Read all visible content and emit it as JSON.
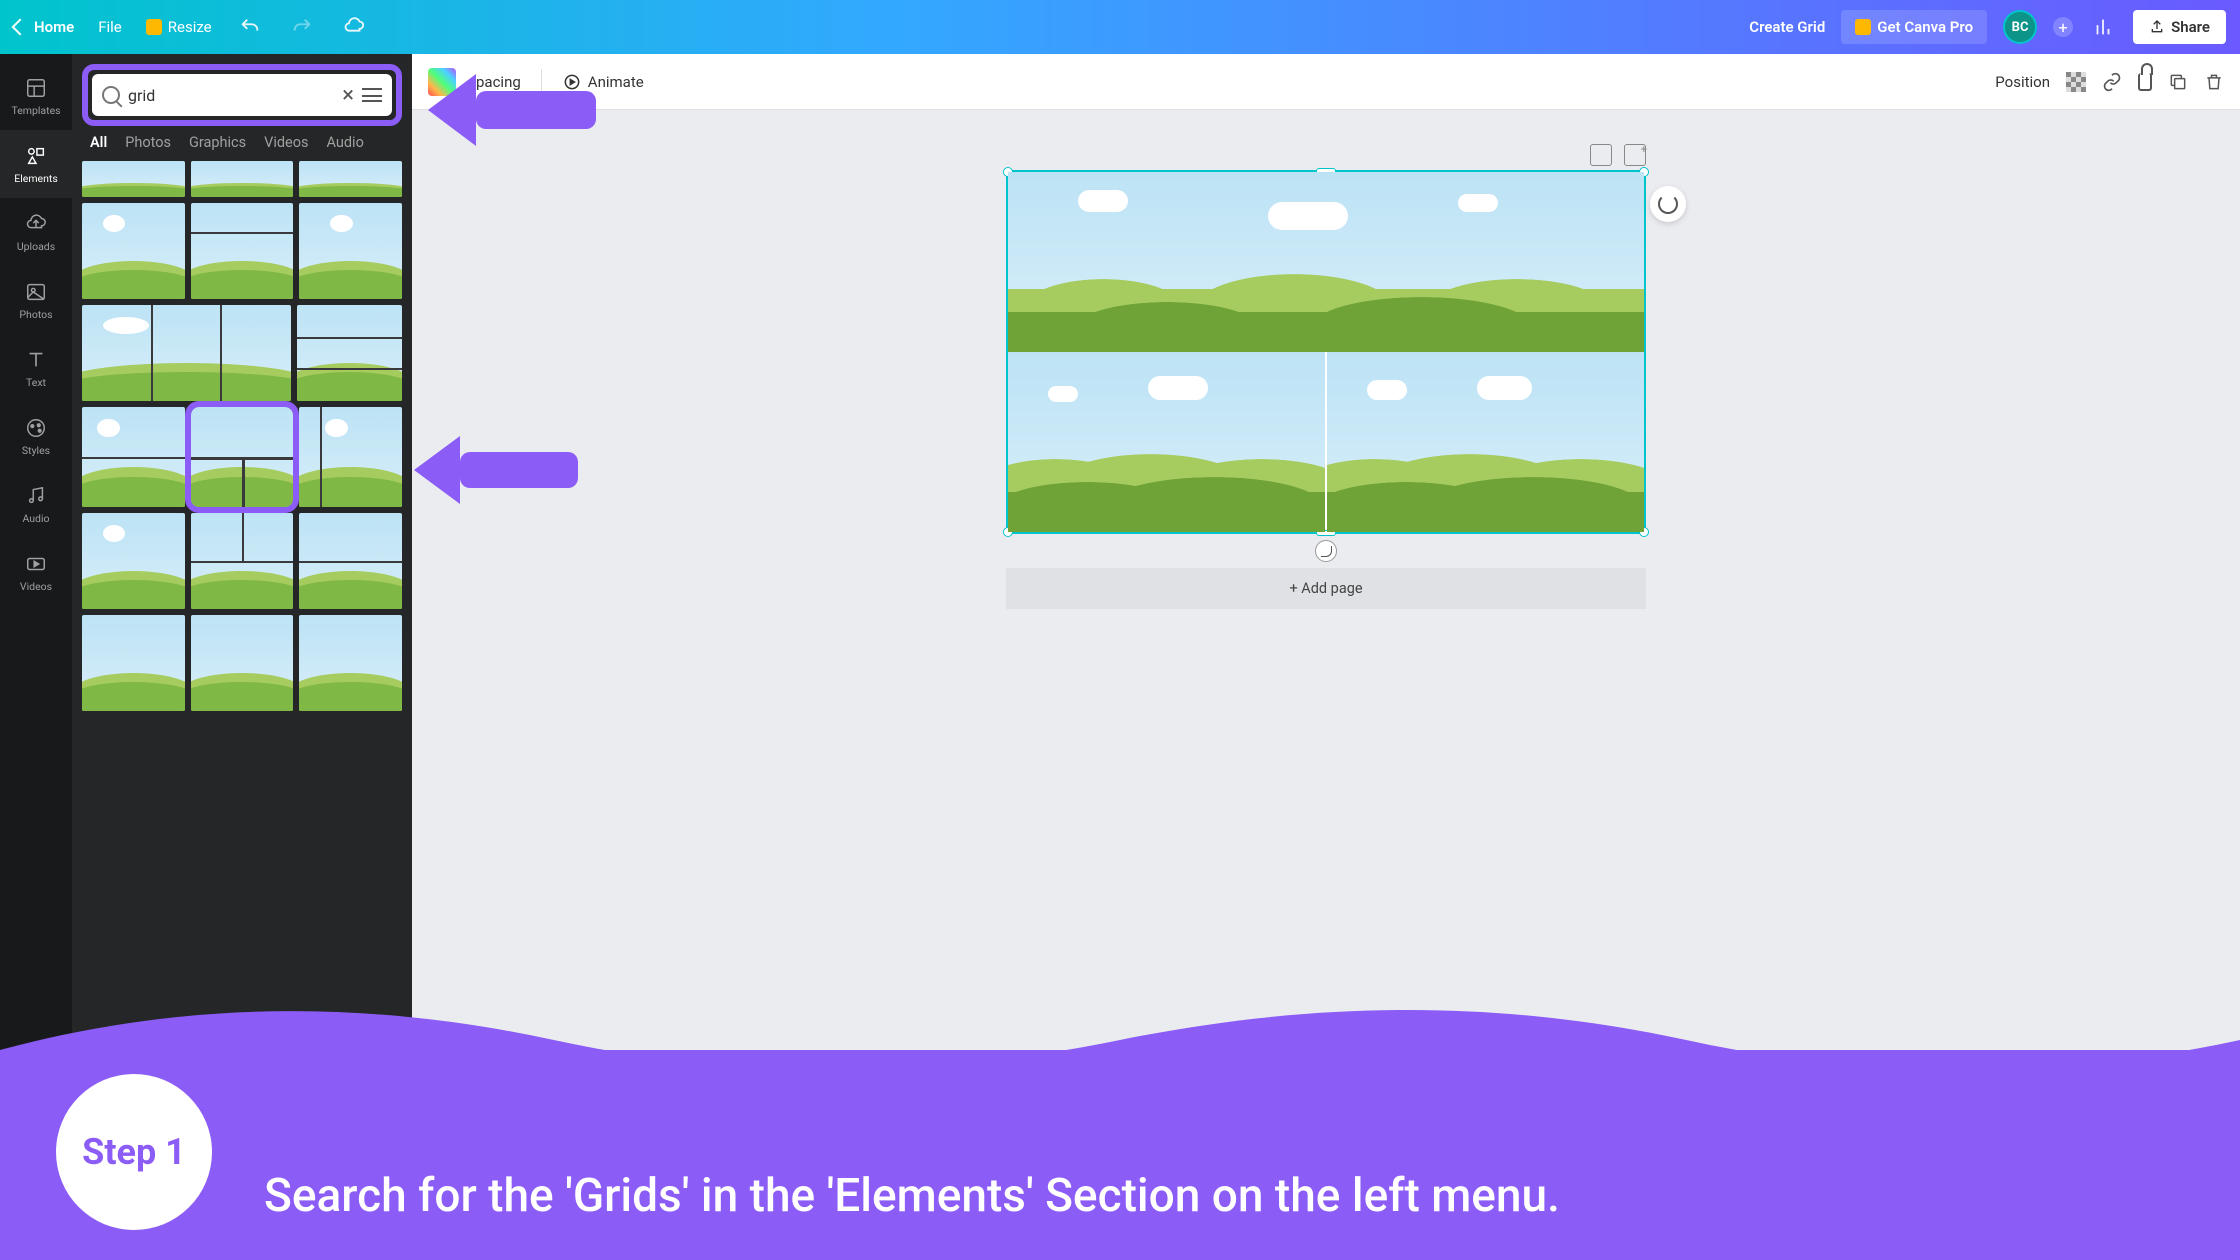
{
  "topbar": {
    "home": "Home",
    "file": "File",
    "resize": "Resize",
    "doc_title": "Create Grid",
    "get_pro": "Get Canva Pro",
    "avatar": "BC",
    "share": "Share"
  },
  "rail": {
    "templates": "Templates",
    "elements": "Elements",
    "uploads": "Uploads",
    "photos": "Photos",
    "text": "Text",
    "styles": "Styles",
    "audio": "Audio",
    "videos": "Videos"
  },
  "panel": {
    "search_value": "grid",
    "tabs": {
      "all": "All",
      "photos": "Photos",
      "graphics": "Graphics",
      "videos": "Videos",
      "audio": "Audio"
    }
  },
  "toolbar2": {
    "spacing": "pacing",
    "animate": "Animate",
    "position": "Position"
  },
  "canvas": {
    "add_page": "+ Add page"
  },
  "overlay": {
    "step": "Step 1",
    "text": "Search for the 'Grids' in the 'Elements' Section on the left menu."
  }
}
